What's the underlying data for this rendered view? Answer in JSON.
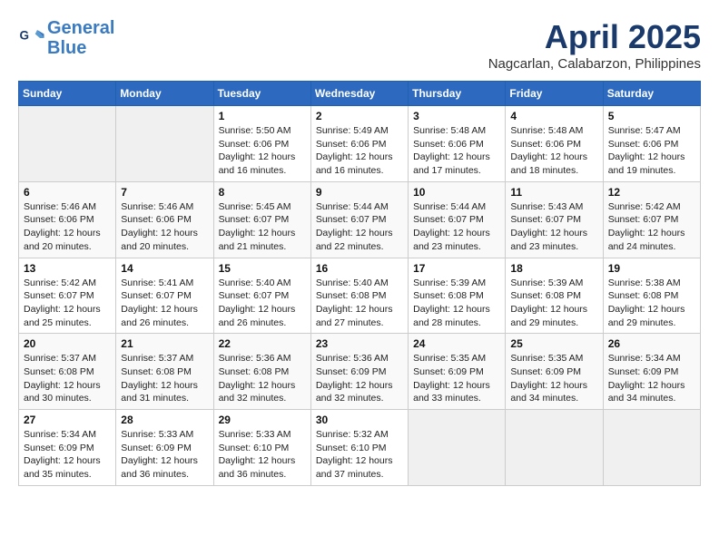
{
  "header": {
    "logo_line1": "General",
    "logo_line2": "Blue",
    "month_year": "April 2025",
    "location": "Nagcarlan, Calabarzon, Philippines"
  },
  "days_of_week": [
    "Sunday",
    "Monday",
    "Tuesday",
    "Wednesday",
    "Thursday",
    "Friday",
    "Saturday"
  ],
  "weeks": [
    [
      {
        "day": "",
        "info": ""
      },
      {
        "day": "",
        "info": ""
      },
      {
        "day": "1",
        "info": "Sunrise: 5:50 AM\nSunset: 6:06 PM\nDaylight: 12 hours and 16 minutes."
      },
      {
        "day": "2",
        "info": "Sunrise: 5:49 AM\nSunset: 6:06 PM\nDaylight: 12 hours and 16 minutes."
      },
      {
        "day": "3",
        "info": "Sunrise: 5:48 AM\nSunset: 6:06 PM\nDaylight: 12 hours and 17 minutes."
      },
      {
        "day": "4",
        "info": "Sunrise: 5:48 AM\nSunset: 6:06 PM\nDaylight: 12 hours and 18 minutes."
      },
      {
        "day": "5",
        "info": "Sunrise: 5:47 AM\nSunset: 6:06 PM\nDaylight: 12 hours and 19 minutes."
      }
    ],
    [
      {
        "day": "6",
        "info": "Sunrise: 5:46 AM\nSunset: 6:06 PM\nDaylight: 12 hours and 20 minutes."
      },
      {
        "day": "7",
        "info": "Sunrise: 5:46 AM\nSunset: 6:06 PM\nDaylight: 12 hours and 20 minutes."
      },
      {
        "day": "8",
        "info": "Sunrise: 5:45 AM\nSunset: 6:07 PM\nDaylight: 12 hours and 21 minutes."
      },
      {
        "day": "9",
        "info": "Sunrise: 5:44 AM\nSunset: 6:07 PM\nDaylight: 12 hours and 22 minutes."
      },
      {
        "day": "10",
        "info": "Sunrise: 5:44 AM\nSunset: 6:07 PM\nDaylight: 12 hours and 23 minutes."
      },
      {
        "day": "11",
        "info": "Sunrise: 5:43 AM\nSunset: 6:07 PM\nDaylight: 12 hours and 23 minutes."
      },
      {
        "day": "12",
        "info": "Sunrise: 5:42 AM\nSunset: 6:07 PM\nDaylight: 12 hours and 24 minutes."
      }
    ],
    [
      {
        "day": "13",
        "info": "Sunrise: 5:42 AM\nSunset: 6:07 PM\nDaylight: 12 hours and 25 minutes."
      },
      {
        "day": "14",
        "info": "Sunrise: 5:41 AM\nSunset: 6:07 PM\nDaylight: 12 hours and 26 minutes."
      },
      {
        "day": "15",
        "info": "Sunrise: 5:40 AM\nSunset: 6:07 PM\nDaylight: 12 hours and 26 minutes."
      },
      {
        "day": "16",
        "info": "Sunrise: 5:40 AM\nSunset: 6:08 PM\nDaylight: 12 hours and 27 minutes."
      },
      {
        "day": "17",
        "info": "Sunrise: 5:39 AM\nSunset: 6:08 PM\nDaylight: 12 hours and 28 minutes."
      },
      {
        "day": "18",
        "info": "Sunrise: 5:39 AM\nSunset: 6:08 PM\nDaylight: 12 hours and 29 minutes."
      },
      {
        "day": "19",
        "info": "Sunrise: 5:38 AM\nSunset: 6:08 PM\nDaylight: 12 hours and 29 minutes."
      }
    ],
    [
      {
        "day": "20",
        "info": "Sunrise: 5:37 AM\nSunset: 6:08 PM\nDaylight: 12 hours and 30 minutes."
      },
      {
        "day": "21",
        "info": "Sunrise: 5:37 AM\nSunset: 6:08 PM\nDaylight: 12 hours and 31 minutes."
      },
      {
        "day": "22",
        "info": "Sunrise: 5:36 AM\nSunset: 6:08 PM\nDaylight: 12 hours and 32 minutes."
      },
      {
        "day": "23",
        "info": "Sunrise: 5:36 AM\nSunset: 6:09 PM\nDaylight: 12 hours and 32 minutes."
      },
      {
        "day": "24",
        "info": "Sunrise: 5:35 AM\nSunset: 6:09 PM\nDaylight: 12 hours and 33 minutes."
      },
      {
        "day": "25",
        "info": "Sunrise: 5:35 AM\nSunset: 6:09 PM\nDaylight: 12 hours and 34 minutes."
      },
      {
        "day": "26",
        "info": "Sunrise: 5:34 AM\nSunset: 6:09 PM\nDaylight: 12 hours and 34 minutes."
      }
    ],
    [
      {
        "day": "27",
        "info": "Sunrise: 5:34 AM\nSunset: 6:09 PM\nDaylight: 12 hours and 35 minutes."
      },
      {
        "day": "28",
        "info": "Sunrise: 5:33 AM\nSunset: 6:09 PM\nDaylight: 12 hours and 36 minutes."
      },
      {
        "day": "29",
        "info": "Sunrise: 5:33 AM\nSunset: 6:10 PM\nDaylight: 12 hours and 36 minutes."
      },
      {
        "day": "30",
        "info": "Sunrise: 5:32 AM\nSunset: 6:10 PM\nDaylight: 12 hours and 37 minutes."
      },
      {
        "day": "",
        "info": ""
      },
      {
        "day": "",
        "info": ""
      },
      {
        "day": "",
        "info": ""
      }
    ]
  ]
}
